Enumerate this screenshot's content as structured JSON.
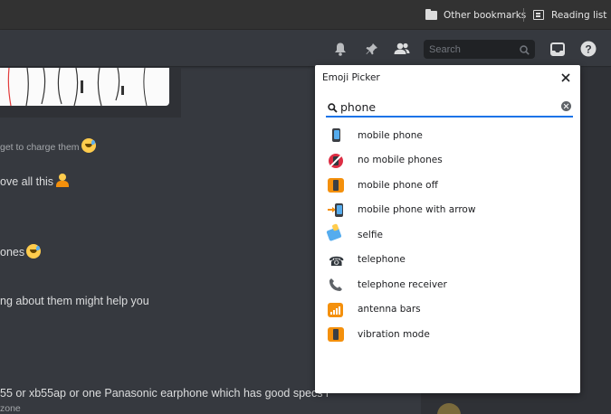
{
  "bookmarks": {
    "other_label": "Other bookmarks",
    "reading_label": "Reading list"
  },
  "header": {
    "icons": [
      "bell-icon",
      "pin-icon",
      "members-icon",
      "inbox-icon",
      "help-icon"
    ],
    "search_placeholder": "Search"
  },
  "chat": {
    "messages": [
      "get to charge them",
      "ove all this",
      "ones",
      "ng about them might help you",
      "55 or xb55ap or one Panasonic earphone which has good specs i",
      "zone"
    ]
  },
  "picker": {
    "title": "Emoji Picker",
    "query": "phone",
    "results": [
      {
        "label": "mobile phone",
        "icon": "mobile-phone-icon"
      },
      {
        "label": "no mobile phones",
        "icon": "no-mobile-phones-icon"
      },
      {
        "label": "mobile phone off",
        "icon": "mobile-phone-off-icon"
      },
      {
        "label": "mobile phone with arrow",
        "icon": "mobile-phone-arrow-icon"
      },
      {
        "label": "selfie",
        "icon": "selfie-icon"
      },
      {
        "label": "telephone",
        "icon": "telephone-icon"
      },
      {
        "label": "telephone receiver",
        "icon": "telephone-receiver-icon"
      },
      {
        "label": "antenna bars",
        "icon": "antenna-bars-icon"
      },
      {
        "label": "vibration mode",
        "icon": "vibration-mode-icon"
      }
    ]
  },
  "colors": {
    "accent": "#1a73e8",
    "background": "#36393f",
    "sidebar": "#2f3136",
    "emoji_orange": "#f4900c"
  }
}
